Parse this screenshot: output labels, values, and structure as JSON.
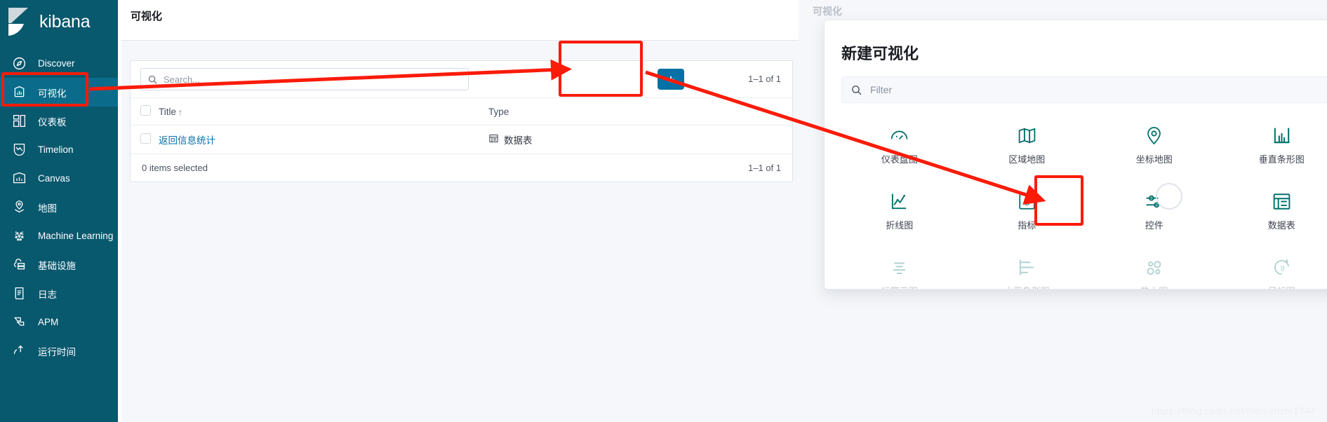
{
  "sidebar": {
    "brand": "kibana",
    "items": [
      {
        "label": "Discover",
        "icon": "compass-icon",
        "active": false
      },
      {
        "label": "可视化",
        "icon": "visualize-icon",
        "active": true
      },
      {
        "label": "仪表板",
        "icon": "dashboard-icon",
        "active": false
      },
      {
        "label": "Timelion",
        "icon": "timelion-icon",
        "active": false
      },
      {
        "label": "Canvas",
        "icon": "canvas-icon",
        "active": false
      },
      {
        "label": "地图",
        "icon": "map-pin-icon",
        "active": false
      },
      {
        "label": "Machine Learning",
        "icon": "machine-learning-icon",
        "active": false
      },
      {
        "label": "基础设施",
        "icon": "infrastructure-icon",
        "active": false
      },
      {
        "label": "日志",
        "icon": "logs-icon",
        "active": false
      },
      {
        "label": "APM",
        "icon": "apm-icon",
        "active": false
      },
      {
        "label": "运行时间",
        "icon": "uptime-icon",
        "active": false
      }
    ]
  },
  "main": {
    "title": "可视化",
    "search": {
      "placeholder": "Search...",
      "value": ""
    },
    "add_button_label": "+",
    "pager_top": "1–1 of 1",
    "pager_bottom": "1–1 of 1",
    "table": {
      "columns": [
        "Title",
        "Type"
      ],
      "sort_indicator": "↑",
      "rows": [
        {
          "title": "返回信息统计",
          "type": "数据表",
          "type_icon": "data-table-icon",
          "checked": false
        }
      ]
    },
    "footer_status": "0 items selected"
  },
  "right_panel": {
    "background_title": "可视化",
    "modal": {
      "title": "新建可视化",
      "filter": {
        "placeholder": "Filter",
        "value": ""
      },
      "types": [
        {
          "label": "仪表盘图",
          "icon": "gauge-icon",
          "faded": false,
          "selected": false
        },
        {
          "label": "区域地图",
          "icon": "region-map-icon",
          "faded": false,
          "selected": false
        },
        {
          "label": "坐标地图",
          "icon": "coordinate-map-icon",
          "faded": false,
          "selected": false
        },
        {
          "label": "垂直条形图",
          "icon": "vertical-bar-icon",
          "faded": false,
          "selected": false
        },
        {
          "label": "折线图",
          "icon": "line-chart-icon",
          "faded": false,
          "selected": false
        },
        {
          "label": "指标",
          "icon": "metric-icon",
          "faded": false,
          "selected": false
        },
        {
          "label": "控件",
          "icon": "controls-icon",
          "faded": false,
          "selected": false
        },
        {
          "label": "数据表",
          "icon": "data-table-icon",
          "faded": false,
          "selected": true
        },
        {
          "label": "标签云图",
          "icon": "tag-cloud-icon",
          "faded": true,
          "selected": false
        },
        {
          "label": "水平条形图",
          "icon": "horizontal-bar-icon",
          "faded": true,
          "selected": false
        },
        {
          "label": "热力图",
          "icon": "heatmap-icon",
          "faded": true,
          "selected": false
        },
        {
          "label": "目标图",
          "icon": "goal-icon",
          "faded": true,
          "selected": false
        }
      ]
    }
  },
  "annotations": {
    "accent_color": "#fb1b09",
    "highlighted": [
      "sidebar-item-可视化",
      "add-visualization-button",
      "vis-type-数据表"
    ]
  },
  "watermark": "https://blog.csdn.net/nienianzhi1744"
}
